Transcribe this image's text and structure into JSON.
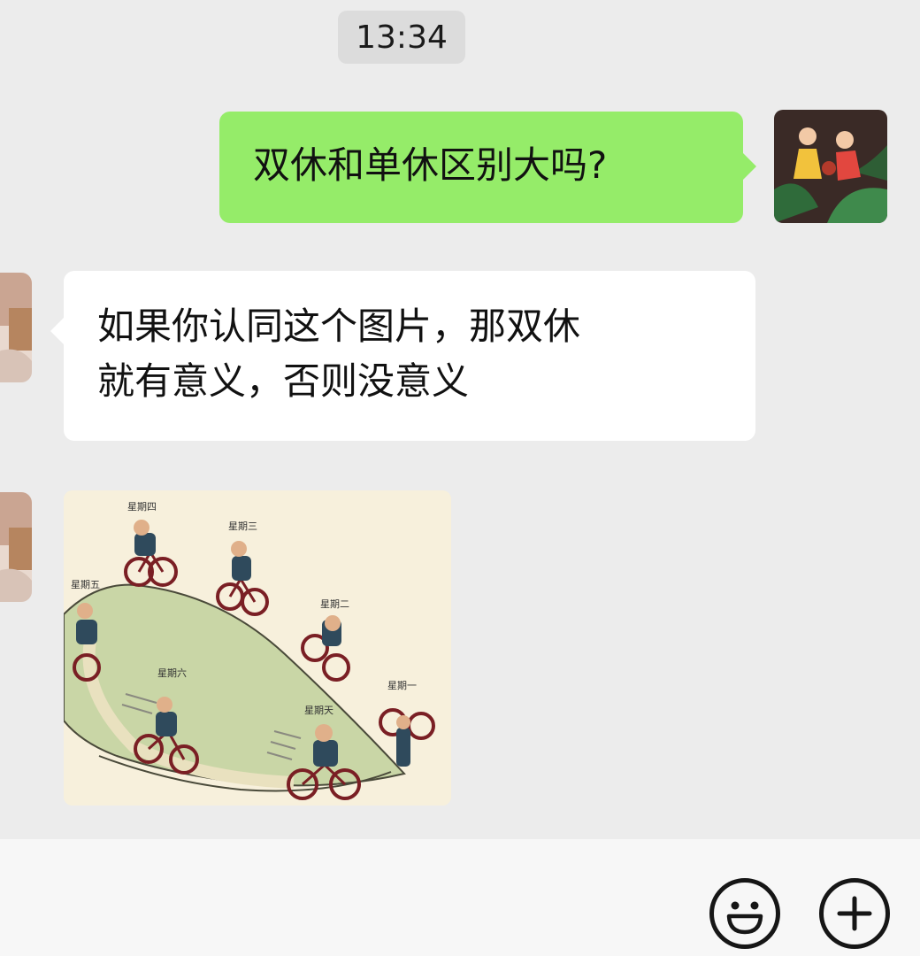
{
  "timestamp": "13:34",
  "messages": [
    {
      "from": "me",
      "type": "text",
      "text": "双休和单休区别大吗?"
    },
    {
      "from": "peer",
      "type": "text",
      "lines": [
        "如果你认同这个图片，那双休",
        "就有意义，否则没意义"
      ]
    },
    {
      "from": "peer",
      "type": "image",
      "image_labels": {
        "thu": "星期四",
        "wed": "星期三",
        "fri": "星期五",
        "tue": "星期二",
        "sat": "星期六",
        "sun": "星期天",
        "mon": "星期一"
      }
    }
  ],
  "input_bar": {
    "icons": [
      "emoji-icon",
      "plus-icon"
    ]
  },
  "colors": {
    "chat_background": "#ececec",
    "sent_bubble": "#95ec69",
    "received_bubble": "#ffffff",
    "time_badge": "#dcdcdc"
  }
}
